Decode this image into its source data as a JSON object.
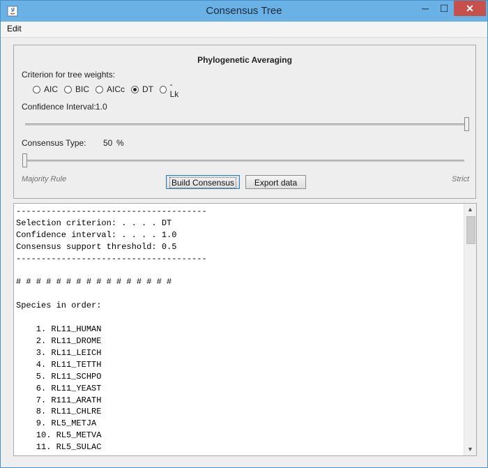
{
  "window": {
    "title": "Consensus Tree",
    "minimize": "─",
    "maximize": "☐",
    "close": "✕"
  },
  "menu": {
    "edit": "Edit"
  },
  "panel": {
    "title": "Phylogenetic Averaging",
    "criterion_label": "Criterion for tree weights:",
    "criteria": [
      {
        "label": "AIC",
        "selected": false
      },
      {
        "label": "BIC",
        "selected": false
      },
      {
        "label": "AICc",
        "selected": false
      },
      {
        "label": "DT",
        "selected": true
      },
      {
        "label": "-Lk",
        "selected": false
      }
    ],
    "confidence_label": "Confidence Interval:",
    "confidence_value": "1.0",
    "confidence_level": 1.0,
    "consensus_label": "Consensus Type:",
    "consensus_value": "50",
    "consensus_unit": "%",
    "consensus_level": 0.0,
    "majority_label": "Majority Rule",
    "strict_label": "Strict",
    "build_button": "Build Consensus",
    "export_button": "Export data"
  },
  "output": {
    "lines": [
      "--------------------------------------",
      "Selection criterion: . . . . DT",
      "Confidence interval: . . . . 1.0",
      "Consensus support threshold: 0.5",
      "--------------------------------------",
      "",
      "# # # # # # # # # # # # # # # #",
      "",
      "Species in order:",
      "",
      "    1. RL11_HUMAN",
      "    2. RL11_DROME",
      "    3. RL11_LEICH",
      "    4. RL11_TETTH",
      "    5. RL11_SCHPO",
      "    6. RL11_YEAST",
      "    7. R111_ARATH",
      "    8. RL11_CHLRE",
      "    9. RL5_METJA",
      "    10. RL5_METVA",
      "    11. RL5_SULAC"
    ]
  }
}
